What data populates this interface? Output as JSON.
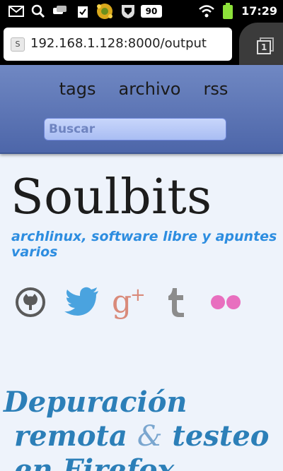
{
  "status_bar": {
    "battery_level_text": "90",
    "time": "17:29"
  },
  "browser": {
    "favicon_letter": "S",
    "url": "192.168.1.128:8000/output",
    "tab_count": "1"
  },
  "nav": {
    "items": [
      {
        "label": "tags"
      },
      {
        "label": "archivo"
      },
      {
        "label": "rss"
      }
    ]
  },
  "search": {
    "placeholder": "Buscar"
  },
  "site": {
    "title": "Soulbits",
    "tagline": "archlinux, software libre y apuntes varios"
  },
  "social": [
    {
      "icon": "github-icon",
      "color": "#555555"
    },
    {
      "icon": "twitter-icon",
      "color": "#4aa3df"
    },
    {
      "icon": "google-plus-icon",
      "color": "#d98a7a"
    },
    {
      "icon": "tumblr-icon",
      "color": "#8c8c8c"
    },
    {
      "icon": "flickr-icon",
      "color": "#e86fbf"
    }
  ],
  "post": {
    "title_line1": "Depuración",
    "title_line2_before": "remota ",
    "title_amp": "&",
    "title_line2_after": " testeo",
    "title_line3": "en Firefox"
  },
  "colors": {
    "header_top": "#7088c3",
    "header_bottom": "#4d66a9",
    "tagline": "#2d8de0",
    "post_title": "#2c7fb8",
    "page_bg": "#eef3fb"
  }
}
